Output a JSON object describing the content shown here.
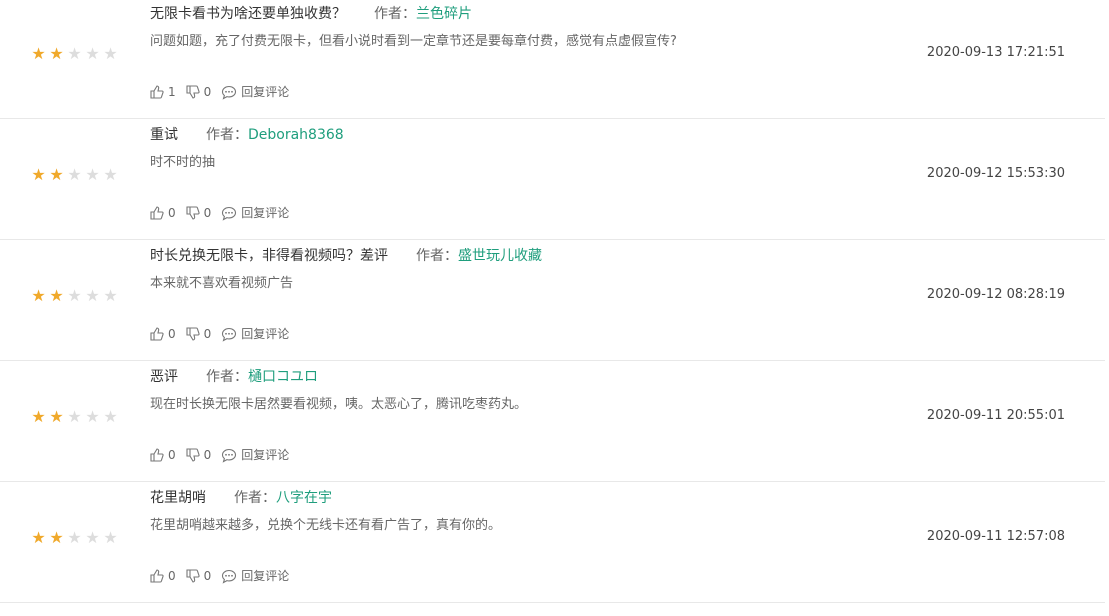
{
  "colors": {
    "star_on": "#f0a92b",
    "star_off": "#dddddd",
    "author": "#1f9e7d"
  },
  "labels": {
    "author_prefix": "作者：",
    "reply": "回复评论"
  },
  "icons": {
    "like": "thumbs-up-icon",
    "dislike": "thumbs-down-icon",
    "reply": "comment-bubble-icon",
    "star": "star-icon"
  },
  "reviews": [
    {
      "title": "无限卡看书为啥还要单独收费？",
      "author": "兰色碎片",
      "content": "问题如题，充了付费无限卡，但看小说时看到一定章节还是要每章付费，感觉有点虚假宣传?",
      "time": "2020-09-13 17:21:51",
      "likes": "1",
      "dislikes": "0",
      "rating": 2
    },
    {
      "title": "重试",
      "author": "Deborah8368",
      "content": "时不时的抽",
      "time": "2020-09-12 15:53:30",
      "likes": "0",
      "dislikes": "0",
      "rating": 2
    },
    {
      "title": "时长兑换无限卡，非得看视频吗？差评",
      "author": "盛世玩儿收藏",
      "content": "本来就不喜欢看视频广告",
      "time": "2020-09-12 08:28:19",
      "likes": "0",
      "dislikes": "0",
      "rating": 2
    },
    {
      "title": "恶评",
      "author": "樋口コユロ",
      "content": "现在时长换无限卡居然要看视频，咦。太恶心了，腾讯吃枣药丸。",
      "time": "2020-09-11 20:55:01",
      "likes": "0",
      "dislikes": "0",
      "rating": 2
    },
    {
      "title": "花里胡哨",
      "author": "八字在宇",
      "content": "花里胡哨越来越多，兑换个无线卡还有看广告了，真有你的。",
      "time": "2020-09-11 12:57:08",
      "likes": "0",
      "dislikes": "0",
      "rating": 2
    }
  ]
}
